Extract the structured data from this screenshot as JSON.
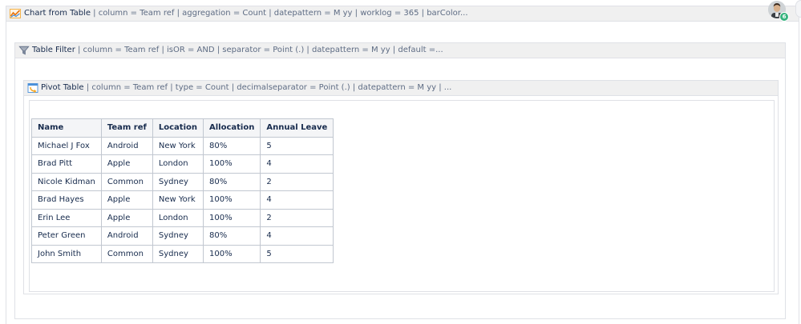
{
  "chart_macro": {
    "title": "Chart from Table",
    "params": " | column = Team ref | aggregation = Count | datepattern = M yy | worklog = 365 | barColor..."
  },
  "filter_macro": {
    "title": "Table Filter",
    "params": " | column = Team ref | isOR = AND | separator = Point (.) | datepattern = M yy | default =..."
  },
  "pivot_macro": {
    "title": "Pivot Table",
    "params": " | column = Team ref | type = Count | decimalseparator = Point (.) | datepattern = M yy | ..."
  },
  "avatar": {
    "badge": "6"
  },
  "table": {
    "headers": [
      "Name",
      "Team ref",
      "Location",
      "Allocation",
      "Annual Leave"
    ],
    "rows": [
      [
        "Michael J Fox",
        "Android",
        "New York",
        "80%",
        "5"
      ],
      [
        "Brad Pitt",
        "Apple",
        "London",
        "100%",
        "4"
      ],
      [
        "Nicole Kidman",
        "Common",
        "Sydney",
        "80%",
        "2"
      ],
      [
        "Brad Hayes",
        "Apple",
        "New York",
        "100%",
        "4"
      ],
      [
        "Erin Lee",
        "Apple",
        "London",
        "100%",
        "2"
      ],
      [
        "Peter Green",
        "Android",
        "Sydney",
        "80%",
        "4"
      ],
      [
        "John Smith",
        "Common",
        "Sydney",
        "100%",
        "5"
      ]
    ]
  },
  "colors": {
    "header_bg": "#f0f0f0",
    "border": "#dfe1e6",
    "table_border": "#c1c7d0",
    "badge": "#36b37e"
  }
}
